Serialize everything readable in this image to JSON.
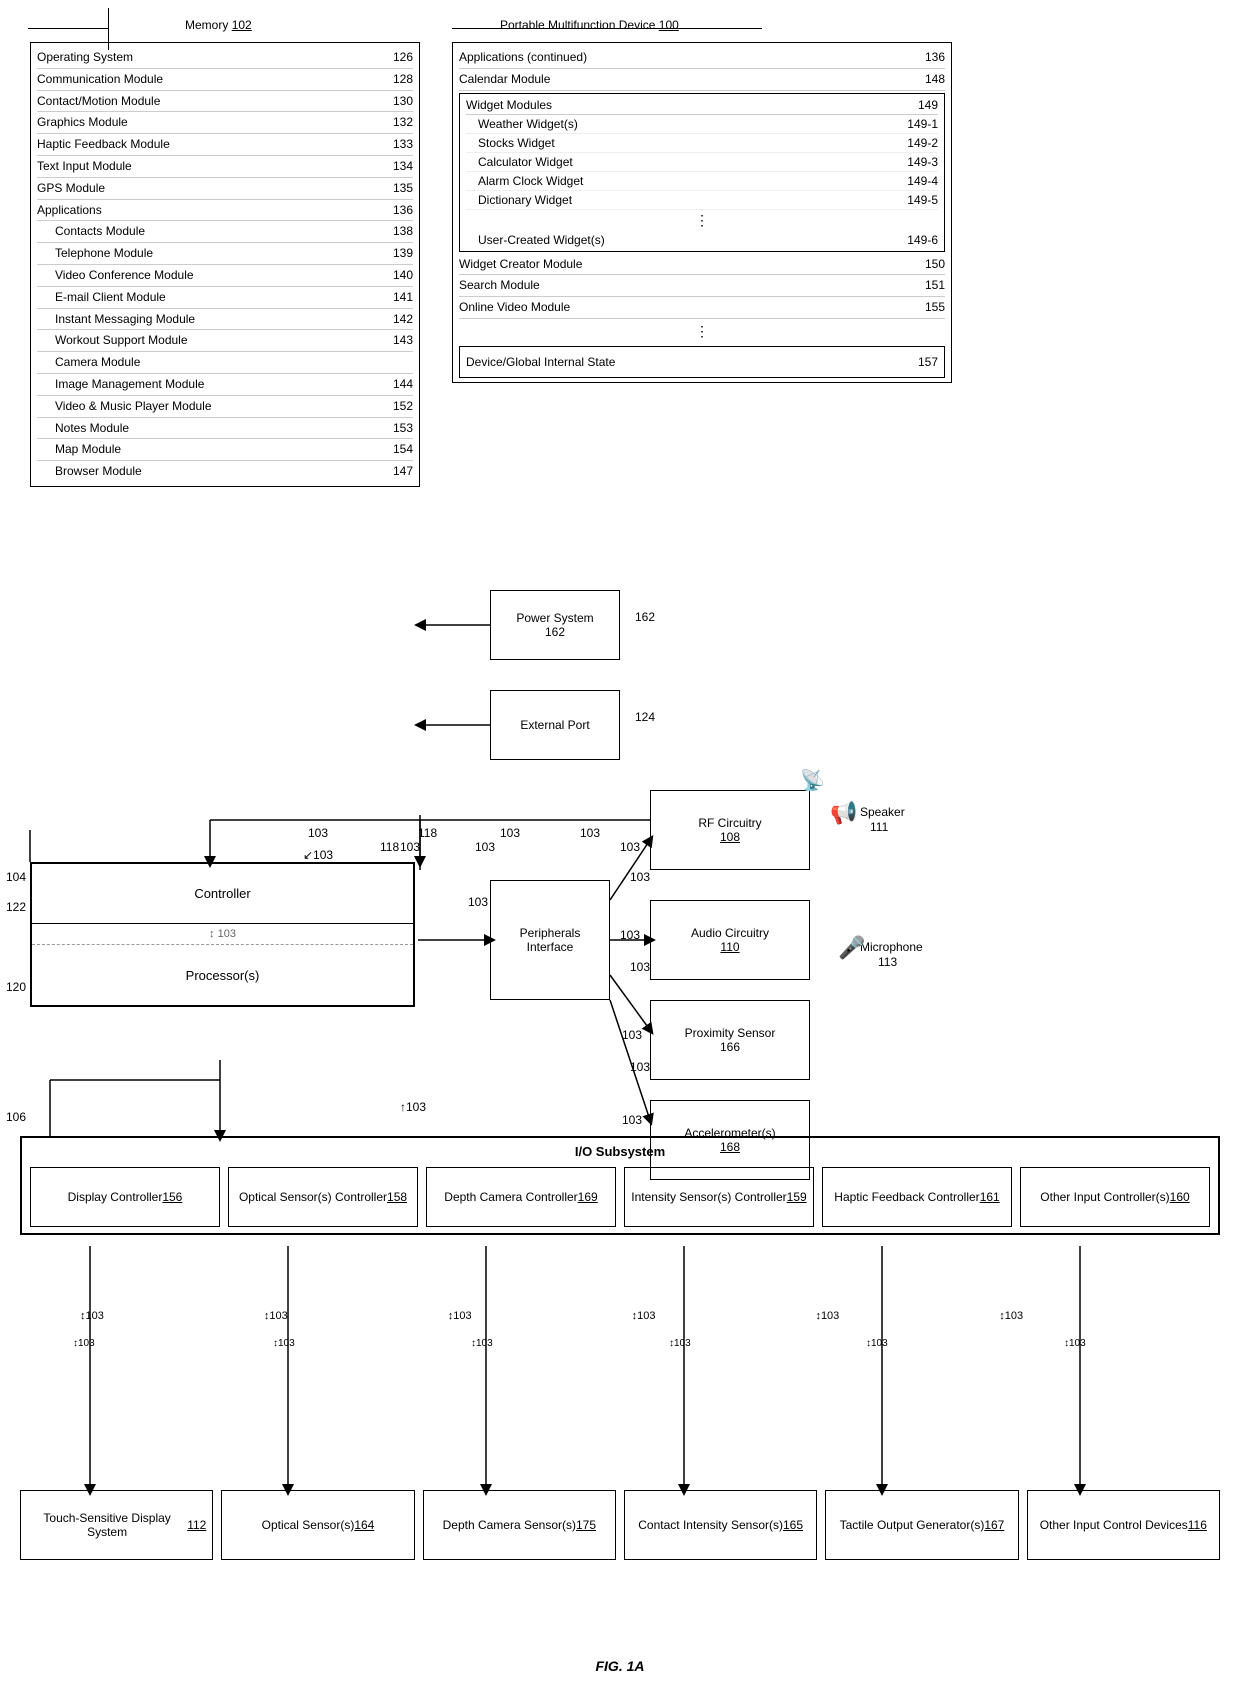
{
  "title": "FIG. 1A",
  "memory": {
    "label": "Memory",
    "ref": "102",
    "rows": [
      {
        "text": "Operating System",
        "num": "126"
      },
      {
        "text": "Communication Module",
        "num": "128"
      },
      {
        "text": "Contact/Motion Module",
        "num": "130"
      },
      {
        "text": "Graphics Module",
        "num": "132"
      },
      {
        "text": "Haptic Feedback Module",
        "num": "133"
      },
      {
        "text": "Text Input Module",
        "num": "134"
      },
      {
        "text": "GPS Module",
        "num": "135"
      },
      {
        "text": "Applications",
        "num": "136",
        "type": "header"
      },
      {
        "text": "Contacts Module",
        "num": "138",
        "sub": true
      },
      {
        "text": "Telephone Module",
        "num": "139",
        "sub": true
      },
      {
        "text": "Video Conference Module",
        "num": "140",
        "sub": true
      },
      {
        "text": "E-mail Client Module",
        "num": "141",
        "sub": true
      },
      {
        "text": "Instant Messaging Module",
        "num": "142",
        "sub": true
      },
      {
        "text": "Workout Support Module",
        "num": "143",
        "sub": true
      },
      {
        "text": "Camera Module",
        "num": "",
        "sub": true
      },
      {
        "text": "Image Management Module",
        "num": "144",
        "sub": true
      },
      {
        "text": "Video & Music Player Module",
        "num": "152",
        "sub": true
      },
      {
        "text": "Notes Module",
        "num": "153",
        "sub": true
      },
      {
        "text": "Map Module",
        "num": "154",
        "sub": true
      },
      {
        "text": "Browser Module",
        "num": "147",
        "sub": true
      }
    ]
  },
  "pmd": {
    "label": "Portable Multifunction Device",
    "ref": "100",
    "rows_top": [
      {
        "text": "Applications (continued)",
        "num": "136"
      },
      {
        "text": "Calendar Module",
        "num": "148"
      }
    ],
    "widget_header": "Widget Modules",
    "widget_ref": "149",
    "widgets": [
      {
        "text": "Weather Widget(s)",
        "num": "149-1"
      },
      {
        "text": "Stocks Widget",
        "num": "149-2"
      },
      {
        "text": "Calculator Widget",
        "num": "149-3"
      },
      {
        "text": "Alarm Clock Widget",
        "num": "149-4"
      },
      {
        "text": "Dictionary Widget",
        "num": "149-5"
      },
      {
        "text": "User-Created Widget(s)",
        "num": "149-6"
      }
    ],
    "rows_bottom": [
      {
        "text": "Widget Creator Module",
        "num": "150"
      },
      {
        "text": "Search Module",
        "num": "151"
      },
      {
        "text": "Online Video Module",
        "num": "155"
      }
    ],
    "device_state": "Device/Global Internal State",
    "device_state_ref": "157"
  },
  "components": {
    "controller": "Controller",
    "processors": "Processor(s)",
    "peripherals": "Peripherals Interface",
    "power_system": "Power System",
    "power_ref": "162",
    "external_port": "External Port",
    "external_ref": "124",
    "rf_circuitry": "RF Circuitry",
    "rf_ref": "108",
    "audio_circuitry": "Audio Circuitry",
    "audio_ref": "110",
    "proximity_sensor": "Proximity Sensor",
    "proximity_ref": "166",
    "accelerometer": "Accelerometer(s)",
    "accel_ref": "168",
    "speaker": "Speaker",
    "speaker_ref": "111",
    "microphone": "Microphone",
    "micro_ref": "113"
  },
  "io_subsystem": {
    "title": "I/O Subsystem",
    "cells": [
      {
        "text": "Display Controller 156",
        "id": "display-ctrl"
      },
      {
        "text": "Optical Sensor(s) Controller 158",
        "id": "optical-ctrl"
      },
      {
        "text": "Depth Camera Controller 169",
        "id": "depth-ctrl"
      },
      {
        "text": "Intensity Sensor(s) Controller 159",
        "id": "intensity-ctrl"
      },
      {
        "text": "Haptic Feedback Controller 161",
        "id": "haptic-ctrl"
      },
      {
        "text": "Other Input Controller(s) 160",
        "id": "other-ctrl"
      }
    ]
  },
  "sensors": {
    "cells": [
      {
        "text": "Touch-Sensitive Display System 112",
        "id": "touch-sensor"
      },
      {
        "text": "Optical Sensor(s) 164",
        "id": "optical-sensor"
      },
      {
        "text": "Depth Camera Sensor(s) 175",
        "id": "depth-sensor"
      },
      {
        "text": "Contact Intensity Sensor(s) 165",
        "id": "contact-sensor"
      },
      {
        "text": "Tactile Output Generator(s) 167",
        "id": "tactile-sensor"
      },
      {
        "text": "Other Input Control Devices 116",
        "id": "other-sensor"
      }
    ]
  },
  "ref_labels": {
    "memory_ref": "102",
    "memory_ref_underline": true,
    "ctrl_num_104": "104",
    "ctrl_num_122": "122",
    "ctrl_num_120": "120",
    "ctrl_num_106": "106",
    "ctrl_num_118": "118",
    "bus_103": "103",
    "io_ref": "106"
  }
}
